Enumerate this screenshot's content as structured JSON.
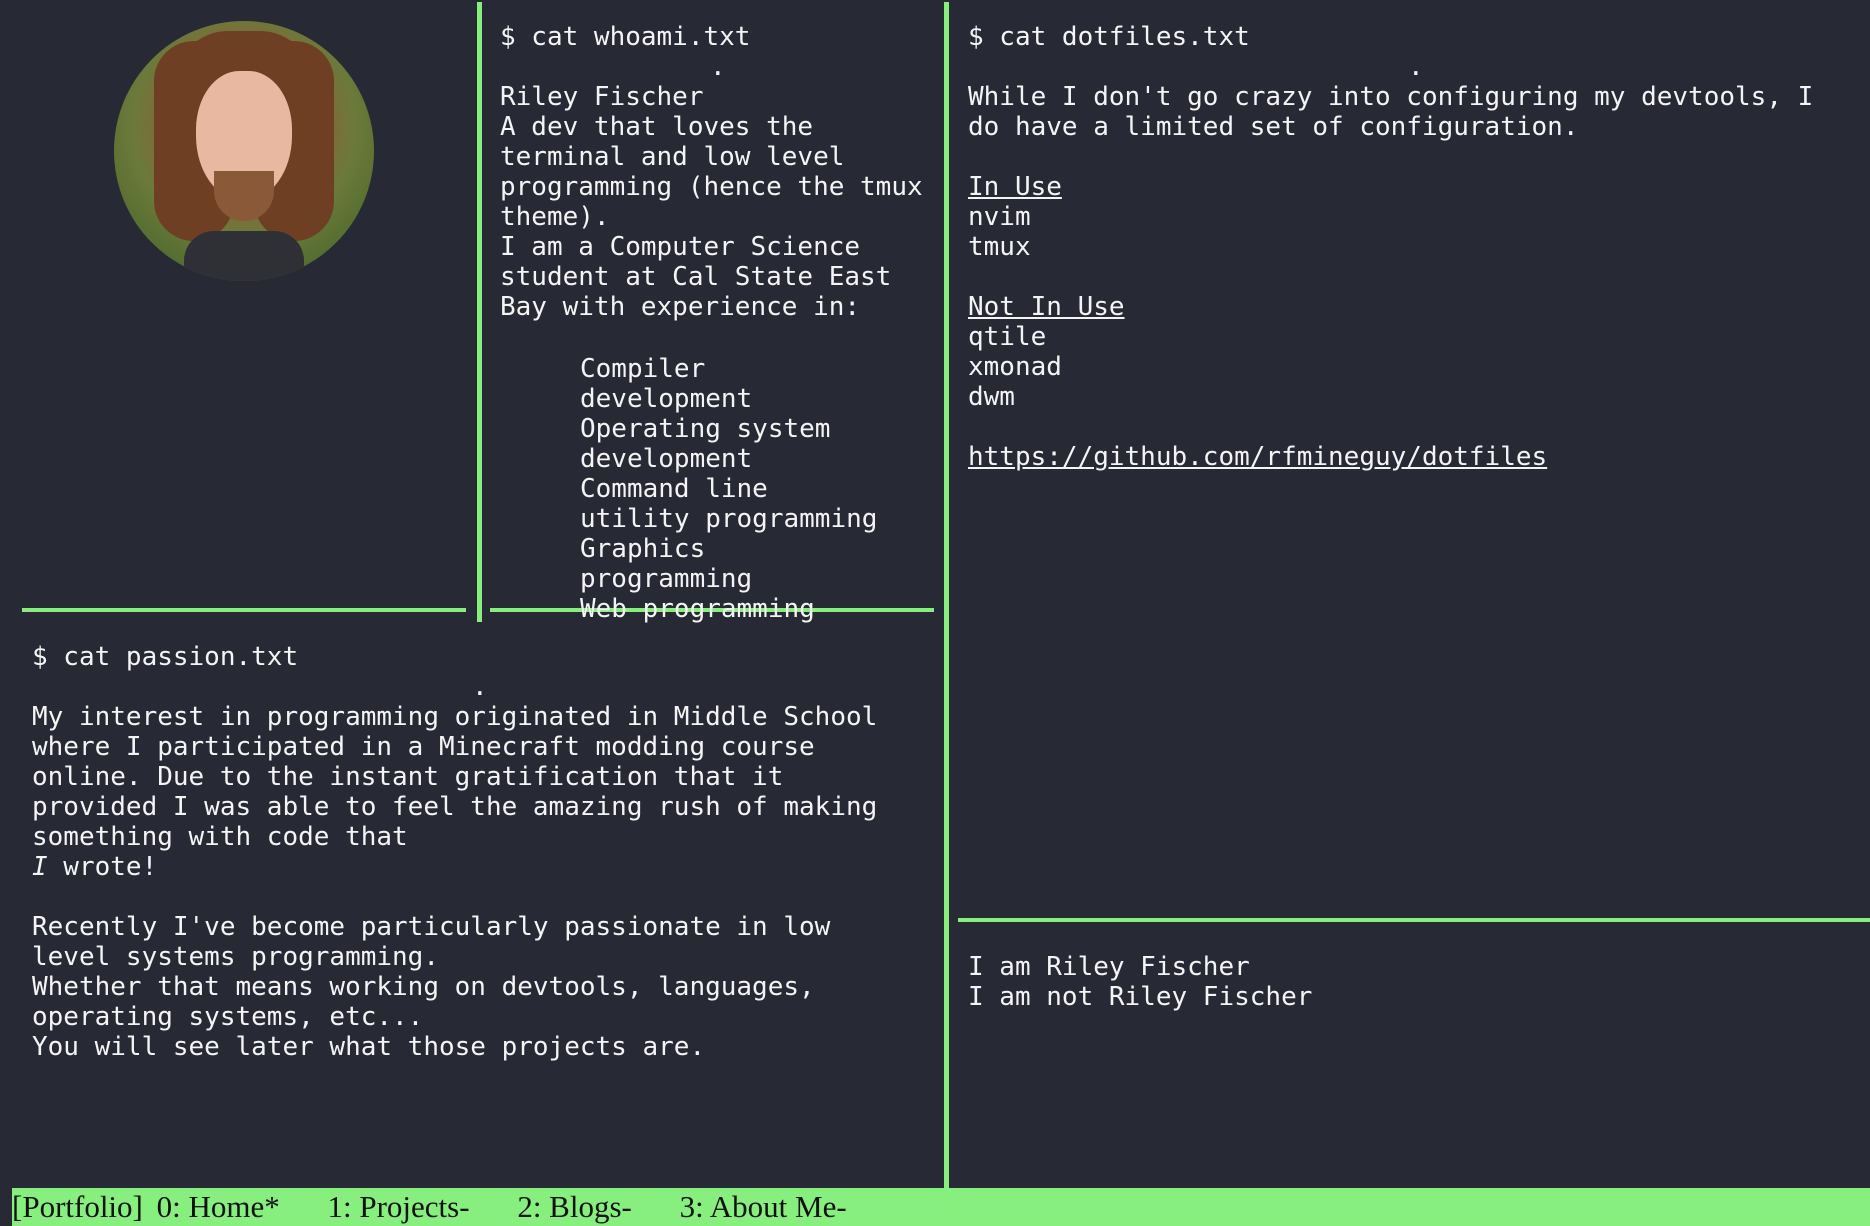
{
  "avatar": {
    "alt": "Riley Fischer"
  },
  "whoami": {
    "prompt": "$ cat whoami.txt",
    "dot": ".",
    "lines": "Riley Fischer\nA dev that loves the\nterminal and low level\nprogramming (hence the tmux\ntheme).\nI am a Computer Science\nstudent at Cal State East\nBay with experience in:",
    "experience": [
      "Compiler development",
      "Operating system development",
      "Command line utility programming",
      "Graphics programming",
      "Web programming"
    ]
  },
  "dotfiles": {
    "prompt": "$ cat dotfiles.txt",
    "dot": ".",
    "intro": "While I don't go crazy into configuring my devtools, I do have a limited set of configuration.",
    "in_use_heading": "In Use",
    "in_use": [
      "nvim",
      "tmux"
    ],
    "not_in_use_heading": "Not In Use",
    "not_in_use": [
      "qtile",
      "xmonad",
      "dwm"
    ],
    "link": "https://github.com/rfmineguy/dotfiles"
  },
  "passion": {
    "prompt": "$ cat passion.txt",
    "dot": ".",
    "para1": "My interest in programming originated in Middle School\nwhere I participated in a Minecraft modding course\nonline. Due to the instant gratification that it\nprovided I was able to feel the amazing rush of making\nsomething with code that",
    "italic_i": "I",
    "wrote": " wrote!",
    "para2": "Recently I've become particularly passionate in low\nlevel systems programming.\nWhether that means working on devtools, languages,\noperating systems, etc...\nYou will see later what those projects are."
  },
  "identity": {
    "line1": "I am Riley Fischer",
    "line2": "I am not Riley Fischer"
  },
  "statusbar": {
    "session": "[Portfolio]",
    "tabs": [
      "0: Home*",
      "1: Projects-",
      "2: Blogs-",
      "3: About Me-"
    ]
  },
  "colors": {
    "background": "#272a35",
    "accent": "#86ef7d",
    "text": "#f4f4f4"
  }
}
